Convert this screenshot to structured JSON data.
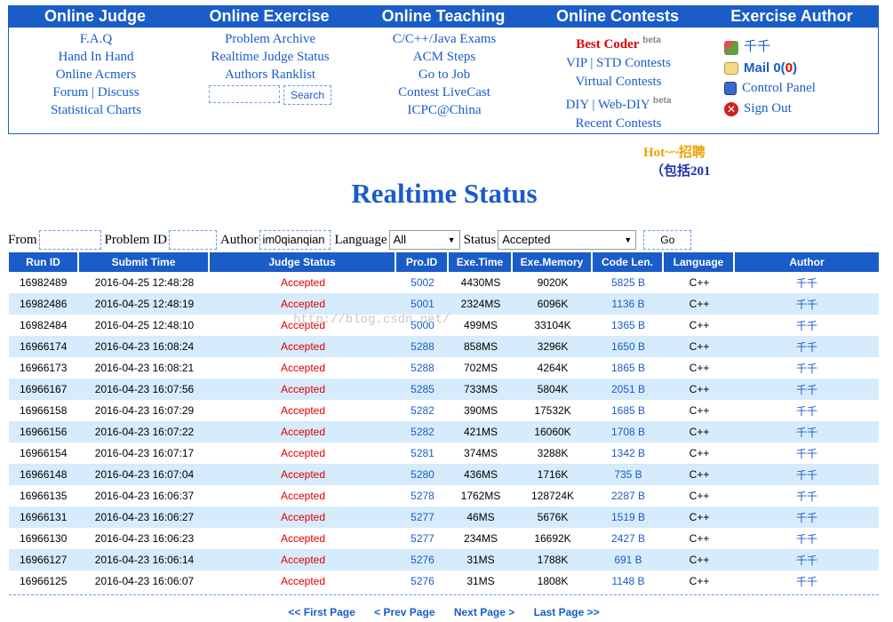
{
  "nav": {
    "headers": [
      "Online Judge",
      "Online Exercise",
      "Online Teaching",
      "Online Contests",
      "Exercise Author"
    ],
    "judge": [
      "F.A.Q",
      "Hand In Hand",
      "Online Acmers",
      "Forum | Discuss",
      "Statistical Charts"
    ],
    "exercise": [
      "Problem Archive",
      "Realtime Judge Status",
      "Authors Ranklist"
    ],
    "search_button": "Search",
    "teaching": [
      "C/C++/Java Exams",
      "ACM Steps",
      "Go to Job",
      "Contest LiveCast",
      "ICPC@China"
    ],
    "contests": {
      "best_coder": "Best Coder",
      "beta": "beta",
      "vip": "VIP | STD Contests",
      "virtual": "Virtual Contests",
      "diy": "DIY | Web-DIY",
      "recent": "Recent Contests"
    },
    "author": {
      "name": "千千",
      "mail_label": "Mail 0(",
      "mail_count": "0",
      "mail_close": ")",
      "control_panel": "Control Panel",
      "sign_out": "Sign Out"
    }
  },
  "hot": {
    "line1": "Hot~~招聘",
    "line2": "（包括201"
  },
  "page_title": "Realtime Status",
  "filter": {
    "from_label": "From",
    "problem_label": "Problem ID",
    "author_label": "Author",
    "author_value": "im0qianqian",
    "language_label": "Language",
    "language_value": "All",
    "status_label": "Status",
    "status_value": "Accepted",
    "go_button": "Go"
  },
  "table": {
    "columns": [
      "Run ID",
      "Submit Time",
      "Judge Status",
      "Pro.ID",
      "Exe.Time",
      "Exe.Memory",
      "Code Len.",
      "Language",
      "Author"
    ],
    "rows": [
      [
        "16982489",
        "2016-04-25 12:48:28",
        "Accepted",
        "5002",
        "4430MS",
        "9020K",
        "5825 B",
        "C++",
        "千千"
      ],
      [
        "16982486",
        "2016-04-25 12:48:19",
        "Accepted",
        "5001",
        "2324MS",
        "6096K",
        "1136 B",
        "C++",
        "千千"
      ],
      [
        "16982484",
        "2016-04-25 12:48:10",
        "Accepted",
        "5000",
        "499MS",
        "33104K",
        "1365 B",
        "C++",
        "千千"
      ],
      [
        "16966174",
        "2016-04-23 16:08:24",
        "Accepted",
        "5288",
        "858MS",
        "3296K",
        "1650 B",
        "C++",
        "千千"
      ],
      [
        "16966173",
        "2016-04-23 16:08:21",
        "Accepted",
        "5288",
        "702MS",
        "4264K",
        "1865 B",
        "C++",
        "千千"
      ],
      [
        "16966167",
        "2016-04-23 16:07:56",
        "Accepted",
        "5285",
        "733MS",
        "5804K",
        "2051 B",
        "C++",
        "千千"
      ],
      [
        "16966158",
        "2016-04-23 16:07:29",
        "Accepted",
        "5282",
        "390MS",
        "17532K",
        "1685 B",
        "C++",
        "千千"
      ],
      [
        "16966156",
        "2016-04-23 16:07:22",
        "Accepted",
        "5282",
        "421MS",
        "16060K",
        "1708 B",
        "C++",
        "千千"
      ],
      [
        "16966154",
        "2016-04-23 16:07:17",
        "Accepted",
        "5281",
        "374MS",
        "3288K",
        "1342 B",
        "C++",
        "千千"
      ],
      [
        "16966148",
        "2016-04-23 16:07:04",
        "Accepted",
        "5280",
        "436MS",
        "1716K",
        "735 B",
        "C++",
        "千千"
      ],
      [
        "16966135",
        "2016-04-23 16:06:37",
        "Accepted",
        "5278",
        "1762MS",
        "128724K",
        "2287 B",
        "C++",
        "千千"
      ],
      [
        "16966131",
        "2016-04-23 16:06:27",
        "Accepted",
        "5277",
        "46MS",
        "5676K",
        "1519 B",
        "C++",
        "千千"
      ],
      [
        "16966130",
        "2016-04-23 16:06:23",
        "Accepted",
        "5277",
        "234MS",
        "16692K",
        "2427 B",
        "C++",
        "千千"
      ],
      [
        "16966127",
        "2016-04-23 16:06:14",
        "Accepted",
        "5276",
        "31MS",
        "1788K",
        "691 B",
        "C++",
        "千千"
      ],
      [
        "16966125",
        "2016-04-23 16:06:07",
        "Accepted",
        "5276",
        "31MS",
        "1808K",
        "1148 B",
        "C++",
        "千千"
      ]
    ]
  },
  "pager": {
    "first": "<< First Page",
    "prev": "< Prev Page",
    "next": "Next Page >",
    "last": "Last Page >>"
  },
  "watermark": "http://blog.csdn.net/",
  "colors": {
    "brand_blue": "#1a5cc8",
    "alt_row": "#d6ebfc",
    "accepted": "#e00000",
    "hot": "#f0a000"
  },
  "icons": {
    "user": "users-icon",
    "mail": "envelope-icon",
    "panel": "notepad-icon",
    "signout": "red-x-icon"
  }
}
